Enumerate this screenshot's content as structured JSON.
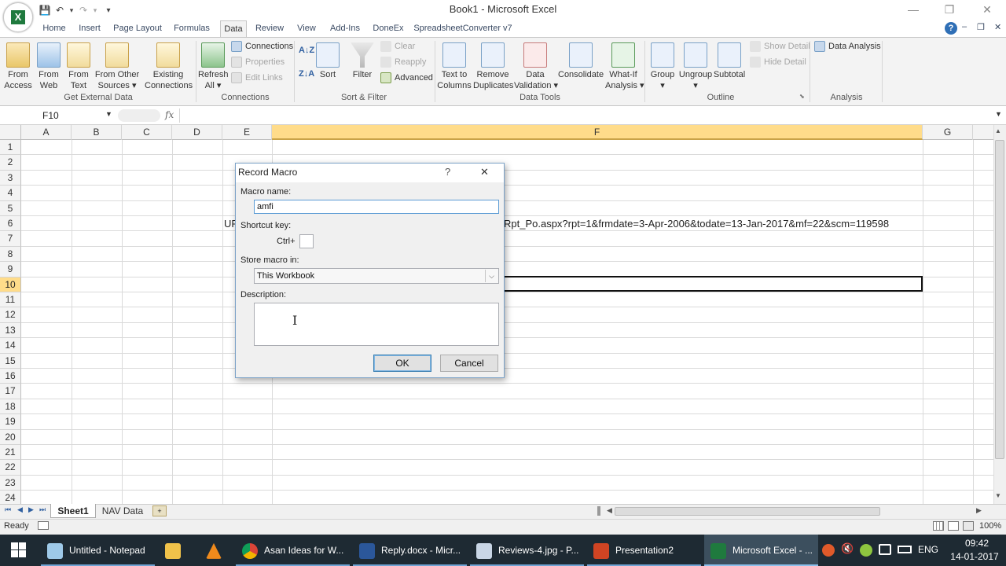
{
  "window": {
    "title": "Book1 - Microsoft Excel",
    "controls": {
      "minimize": "—",
      "restore": "❐",
      "close": "✕"
    }
  },
  "quick_access": {
    "save": "💾",
    "undo": "↶",
    "redo": "↷",
    "customize": "▾"
  },
  "tabs": [
    "Home",
    "Insert",
    "Page Layout",
    "Formulas",
    "Data",
    "Review",
    "View",
    "Add-Ins",
    "DoneEx",
    "SpreadsheetConverter v7"
  ],
  "active_tab": "Data",
  "ribbon": {
    "get_external_data": {
      "group_label": "Get External Data",
      "from_access": "From\nAccess",
      "from_web": "From\nWeb",
      "from_text": "From\nText",
      "from_other": "From Other\nSources ▾",
      "existing": "Existing\nConnections"
    },
    "connections": {
      "group_label": "Connections",
      "refresh": "Refresh\nAll ▾",
      "connections": "Connections",
      "properties": "Properties",
      "edit_links": "Edit Links"
    },
    "sort_filter": {
      "group_label": "Sort & Filter",
      "sort": "Sort",
      "filter": "Filter",
      "clear": "Clear",
      "reapply": "Reapply",
      "advanced": "Advanced"
    },
    "data_tools": {
      "group_label": "Data Tools",
      "text_to_columns": "Text to\nColumns",
      "remove_duplicates": "Remove\nDuplicates",
      "data_validation": "Data\nValidation ▾",
      "consolidate": "Consolidate",
      "what_if": "What-If\nAnalysis ▾"
    },
    "outline": {
      "group_label": "Outline",
      "group": "Group\n▾",
      "ungroup": "Ungroup\n▾",
      "subtotal": "Subtotal",
      "show_detail": "Show Detail",
      "hide_detail": "Hide Detail"
    },
    "analysis": {
      "group_label": "Analysis",
      "data_analysis": "Data Analysis"
    }
  },
  "formula_bar": {
    "name_box": "F10",
    "fx": "fx",
    "content": ""
  },
  "columns": [
    "A",
    "B",
    "C",
    "D",
    "E",
    "F",
    "G"
  ],
  "rows": [
    "1",
    "2",
    "3",
    "4",
    "5",
    "6",
    "7",
    "8",
    "9",
    "10",
    "11",
    "12",
    "13",
    "14",
    "15",
    "16",
    "17",
    "18",
    "19",
    "20",
    "21",
    "22",
    "23",
    "24"
  ],
  "selected_cell": "F10",
  "cells": {
    "E6_visible": "UR",
    "F6_visible": "Rpt_Po.aspx?rpt=1&frmdate=3-Apr-2006&todate=13-Jan-2017&mf=22&scm=119598"
  },
  "dialog": {
    "title": "Record Macro",
    "help": "?",
    "close": "✕",
    "macro_name_label": "Macro name:",
    "macro_name_value": "amfi",
    "shortcut_label": "Shortcut key:",
    "ctrl_label": "Ctrl+",
    "shortcut_value": "",
    "store_label": "Store macro in:",
    "store_value": "This Workbook",
    "description_label": "Description:",
    "description_value": "",
    "ok": "OK",
    "cancel": "Cancel"
  },
  "sheets": [
    "Sheet1",
    "NAV Data"
  ],
  "active_sheet": "Sheet1",
  "status": {
    "ready": "Ready",
    "zoom": "100%"
  },
  "taskbar": {
    "items": [
      "Untitled - Notepad",
      "Asan Ideas for W...",
      "Reply.docx - Micr...",
      "Reviews-4.jpg - P...",
      "Presentation2",
      "Microsoft Excel - ..."
    ],
    "language": "ENG",
    "time": "09:42",
    "date": "14-01-2017"
  },
  "colors": {
    "accent_green": "#1f7a3e",
    "selection_header": "#ffdc8a",
    "taskbar": "#1e2a33"
  }
}
